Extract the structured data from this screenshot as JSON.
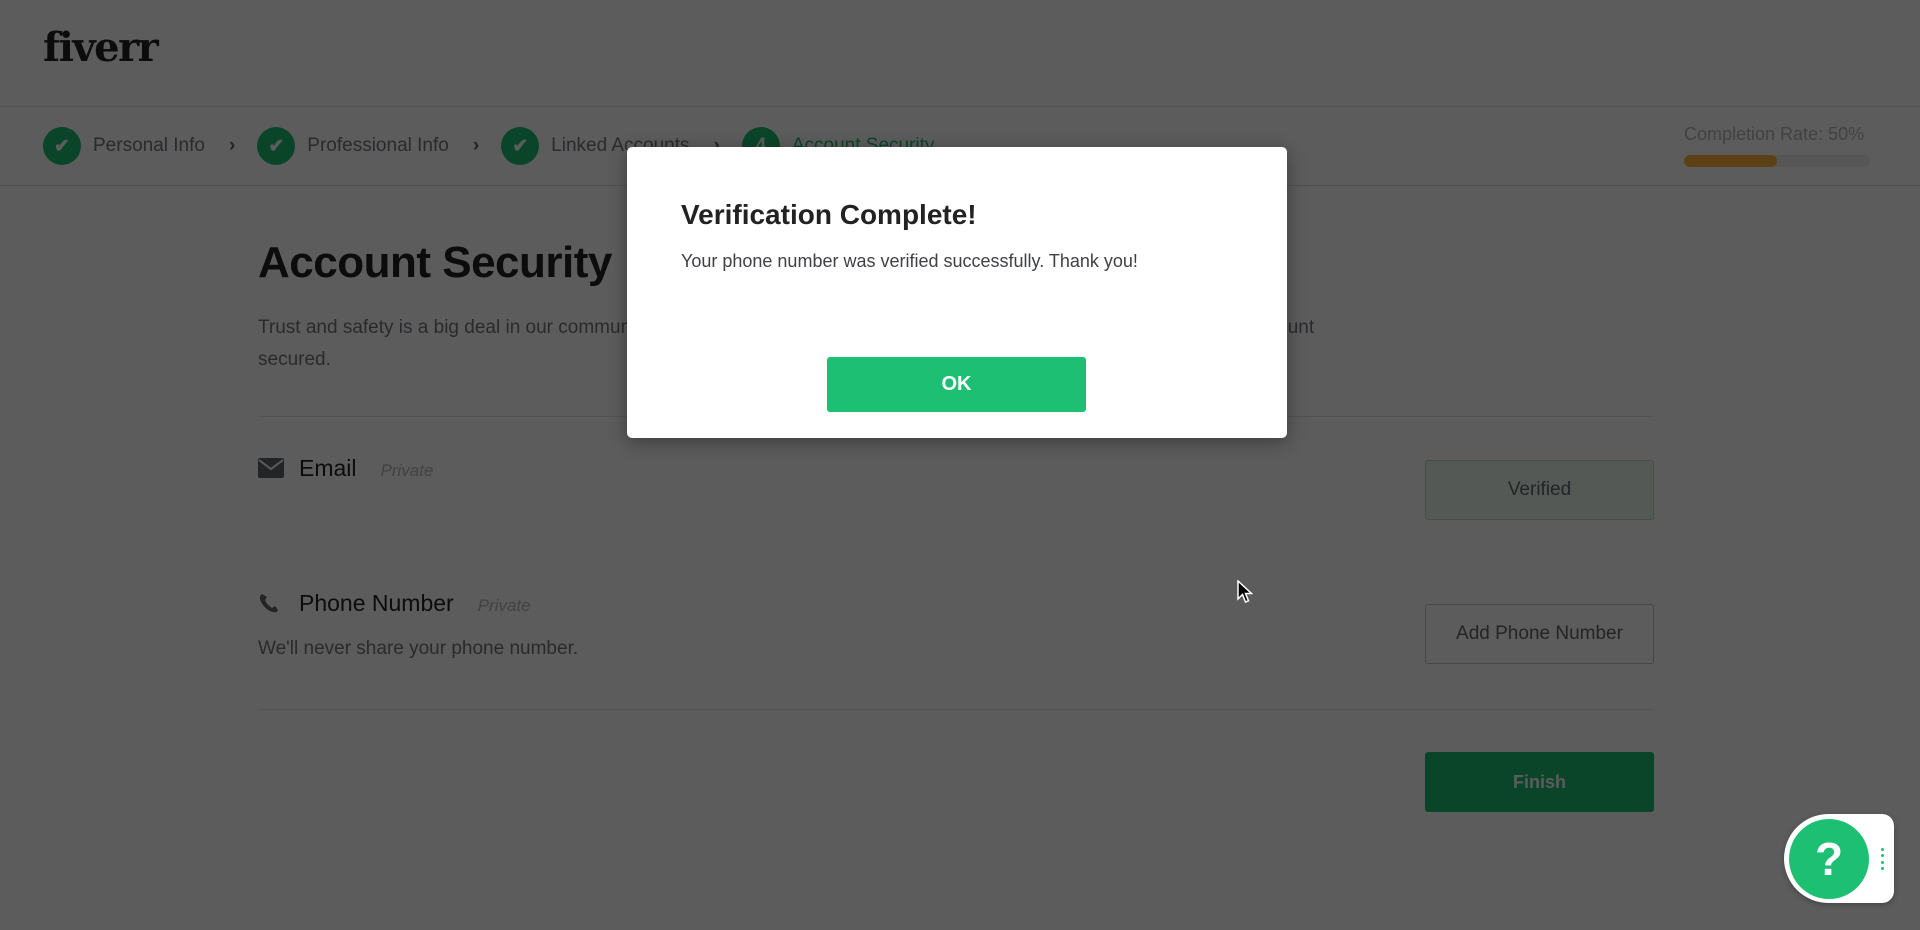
{
  "header": {
    "logo": "fiverr"
  },
  "steps": [
    {
      "label": "Personal Info",
      "status": "complete",
      "marker": "✔"
    },
    {
      "label": "Professional Info",
      "status": "complete",
      "marker": "✔"
    },
    {
      "label": "Linked Accounts",
      "status": "complete",
      "marker": "✔"
    },
    {
      "label": "Account Security",
      "status": "active",
      "marker": "4"
    }
  ],
  "step_separator": "›",
  "completion": {
    "label": "Completion Rate: 50%",
    "percent": 50
  },
  "page": {
    "title": "Account Security",
    "intro": "Trust and safety is a big deal in our community. Please verify your email and phone number so that we can keep your account secured."
  },
  "rows": {
    "email": {
      "icon": "envelope-icon",
      "name": "Email",
      "privacy": "Private",
      "button": "Verified"
    },
    "phone": {
      "icon": "phone-icon",
      "name": "Phone Number",
      "privacy": "Private",
      "subtext": "We'll never share your phone number.",
      "button": "Add Phone Number"
    }
  },
  "finish_button": "Finish",
  "modal": {
    "title": "Verification Complete!",
    "body": "Your phone number was verified successfully. Thank you!",
    "ok_button": "OK"
  },
  "help_widget": {
    "icon_text": "?"
  },
  "colors": {
    "brand_green": "#1dbf73",
    "progress_fill": "#ffb33e",
    "overlay": "rgba(0,0,0,0.64)"
  }
}
